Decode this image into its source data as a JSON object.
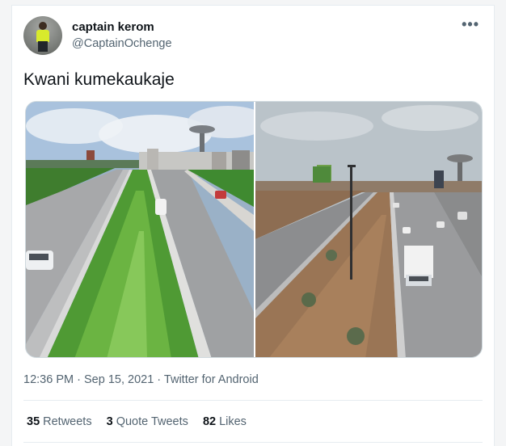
{
  "author": {
    "name": "captain kerom",
    "handle": "@CaptainOchenge",
    "avatar_icon": "person-in-hi-vis-vest-avatar"
  },
  "more_icon": "more-options-icon",
  "tweet": {
    "text": "Kwani kumekaukaje"
  },
  "media": {
    "images": [
      {
        "icon": "highway-green-median-photo"
      },
      {
        "icon": "highway-dry-median-photo"
      }
    ]
  },
  "meta": {
    "time": "12:36 PM",
    "sep1": "·",
    "date": "Sep 15, 2021",
    "sep2": "·",
    "source": "Twitter for Android"
  },
  "stats": {
    "retweets_count": "35",
    "retweets_label": "Retweets",
    "quote_count": "3",
    "quote_label": "Quote Tweets",
    "likes_count": "82",
    "likes_label": "Likes"
  },
  "colors": {
    "text_primary": "#0f1419",
    "text_secondary": "#536471",
    "border": "#e6ecf0"
  }
}
